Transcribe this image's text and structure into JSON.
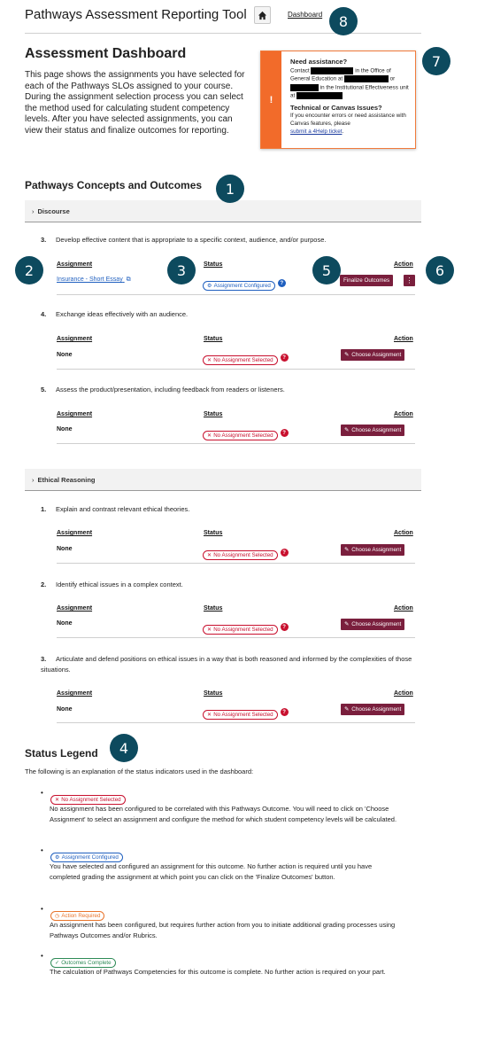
{
  "header": {
    "app_title": "Pathways Assessment Reporting Tool",
    "home_icon": "home-icon",
    "breadcrumb": "Dashboard"
  },
  "page": {
    "title": "Assessment Dashboard",
    "intro": "This page shows the assignments you have selected for each of the Pathways SLOs assigned to your course. During the assignment selection process you can select the method used for calculating student competency levels. After you have selected assignments, you can view their status and finalize outcomes for reporting."
  },
  "help_box": {
    "icon": "!",
    "heading": "Need assistance?",
    "contact_1": "Contact",
    "contact_2": "in the Office of General Education at",
    "contact_3": "or",
    "contact_4": "in the Institutional Effectiveness unit at",
    "tech_heading": "Technical or Canvas Issues?",
    "tech_text": "If you encounter errors or need assistance with Canvas features, please",
    "tech_link": "submit a 4Help ticket",
    "tech_end": "."
  },
  "concepts": {
    "title": "Pathways Concepts and Outcomes",
    "columns": {
      "assignment": "Assignment",
      "status": "Status",
      "action": "Action"
    },
    "discourse": {
      "label": "Discourse",
      "outcomes": [
        {
          "num": "3.",
          "text": "Develop effective content that is appropriate to a specific context, audience, and/or purpose.",
          "assignment": "Insurance - Short Essay",
          "status": "Assignment Configured",
          "action": "Finalize Outcomes"
        },
        {
          "num": "4.",
          "text": "Exchange ideas effectively with an audience.",
          "assignment": "None",
          "status": "No Assignment Selected",
          "action": "Choose Assignment"
        },
        {
          "num": "5.",
          "text": "Assess the product/presentation, including feedback from readers or listeners.",
          "assignment": "None",
          "status": "No Assignment Selected",
          "action": "Choose Assignment"
        }
      ]
    },
    "ethical": {
      "label": "Ethical Reasoning",
      "outcomes": [
        {
          "num": "1.",
          "text": "Explain and contrast relevant ethical theories.",
          "assignment": "None",
          "status": "No Assignment Selected",
          "action": "Choose Assignment"
        },
        {
          "num": "2.",
          "text": "Identify ethical issues in a complex context.",
          "assignment": "None",
          "status": "No Assignment Selected",
          "action": "Choose Assignment"
        },
        {
          "num": "3.",
          "text": "Articulate and defend positions on ethical issues in a way that is both reasoned and informed by the complexities of those situations.",
          "assignment": "None",
          "status": "No Assignment Selected",
          "action": "Choose Assignment"
        }
      ]
    }
  },
  "legend": {
    "title": "Status Legend",
    "intro": "The following is an explanation of the status indicators used in the dashboard:",
    "items": [
      {
        "badge": "No Assignment Selected",
        "text": "No assignment has been configured to be correlated with this Pathways Outcome. You will need to click on 'Choose Assignment' to select an assignment and configure the method for which student competency levels will be calculated."
      },
      {
        "badge": "Assignment Configured",
        "text": "You have selected and configured an assignment for this outcome. No further action is required until you have completed grading the assignment at which point you can click on the 'Finalize Outcomes' button."
      },
      {
        "badge": "Action Required",
        "text": "An assignment has been configured, but requires further action from you to initiate additional grading processes using Pathways Outcomes and/or Rubrics."
      },
      {
        "badge": "Outcomes Complete",
        "text": "The calculation of Pathways Competencies for this outcome is complete. No further action is required on your part."
      }
    ]
  },
  "markers": [
    "1",
    "2",
    "3",
    "4",
    "5",
    "6",
    "7",
    "8"
  ],
  "colors": {
    "marker": "#0d4a5e",
    "button": "#7a1f3d",
    "help_accent": "#f26b2a",
    "error": "#c8102e",
    "info": "#1f5fbf",
    "warning": "#e8742b",
    "success": "#2e8b57"
  }
}
